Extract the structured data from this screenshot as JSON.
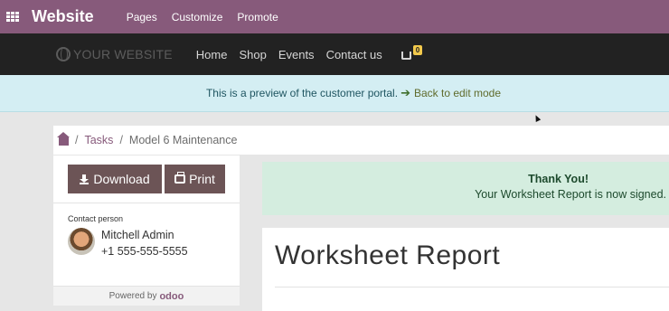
{
  "topbar": {
    "brand": "Website",
    "nav": [
      "Pages",
      "Customize",
      "Promote"
    ]
  },
  "site_nav": {
    "logo_text": "YOUR WEBSITE",
    "menu": [
      "Home",
      "Shop",
      "Events",
      "Contact us"
    ],
    "cart_count": "0"
  },
  "preview_banner": {
    "message": "This is a preview of the customer portal.",
    "back_link": "Back to edit mode"
  },
  "breadcrumb": {
    "items": [
      "Tasks",
      "Model 6 Maintenance"
    ]
  },
  "sidebar": {
    "download_label": "Download",
    "print_label": "Print",
    "contact_label": "Contact person",
    "contact_name": "Mitchell Admin",
    "contact_phone": "+1 555-555-5555",
    "powered_by": "Powered by",
    "powered_brand": "odoo"
  },
  "alert": {
    "title": "Thank You!",
    "message": "Your Worksheet Report is now signed."
  },
  "report": {
    "title": "Worksheet Report"
  },
  "colors": {
    "brand": "#875a7b",
    "site_nav_bg": "#222222",
    "preview_bg": "#d4eef3",
    "success_bg": "#d4eddf",
    "button_bg": "#6c5456"
  }
}
